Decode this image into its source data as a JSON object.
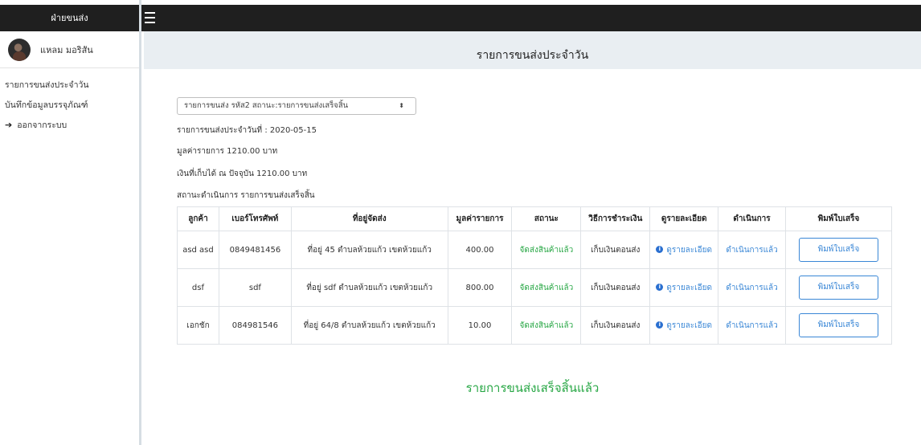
{
  "sidebar": {
    "header": "ฝ่ายขนส่ง",
    "user_name": "แหลม มอริสัน",
    "items": [
      {
        "label": "รายการขนส่งประจำวัน"
      },
      {
        "label": "บันทึกข้อมูลบรรจุภัณฑ์"
      },
      {
        "label": "ออกจากระบบ",
        "icon": "sign-out-icon"
      }
    ]
  },
  "main": {
    "title": "รายการขนส่งประจำวัน",
    "select_value": "รายการขนส่ง รหัส2 สถานะ:รายการขนส่งเสร็จสิ้น",
    "info": {
      "date": "รายการขนส่งประจำวันที่ : 2020-05-15",
      "total": "มูลค่ารายการ 1210.00 บาท",
      "collected": "เงินที่เก็บได้ ณ ปัจจุบัน 1210.00 บาท",
      "status": "สถานะดำเนินการ รายการขนส่งเสร็จสิ้น"
    },
    "table": {
      "headers": [
        "ลูกค้า",
        "เบอร์โทรศัพท์",
        "ที่อยู่จัดส่ง",
        "มูลค่ารายการ",
        "สถานะ",
        "วิธีการชำระเงิน",
        "ดูรายละเอียด",
        "ดำเนินการ",
        "พิมพ์ใบเสร็จ"
      ],
      "rows": [
        {
          "customer": "asd asd",
          "phone": "0849481456",
          "address": "ที่อยู่ 45 ตำบลห้วยแก้ว เขตห้วยแก้ว",
          "amount": "400.00",
          "status": "จัดส่งสินค้าแล้ว",
          "payment": "เก็บเงินตอนส่ง",
          "detail": "ดูรายละเอียด",
          "action": "ดำเนินการแล้ว",
          "print": "พิมพ์ใบเสร็จ"
        },
        {
          "customer": "dsf",
          "phone": "sdf",
          "address": "ที่อยู่ sdf ตำบลห้วยแก้ว เขตห้วยแก้ว",
          "amount": "800.00",
          "status": "จัดส่งสินค้าแล้ว",
          "payment": "เก็บเงินตอนส่ง",
          "detail": "ดูรายละเอียด",
          "action": "ดำเนินการแล้ว",
          "print": "พิมพ์ใบเสร็จ"
        },
        {
          "customer": "เอกชัก",
          "phone": "084981546",
          "address": "ที่อยู่ 64/8 ตำบลห้วยแก้ว เขตห้วยแก้ว",
          "amount": "10.00",
          "status": "จัดส่งสินค้าแล้ว",
          "payment": "เก็บเงินตอนส่ง",
          "detail": "ดูรายละเอียด",
          "action": "ดำเนินการแล้ว",
          "print": "พิมพ์ใบเสร็จ"
        }
      ]
    },
    "done_message": "รายการขนส่งเสร็จสิ้นแล้ว"
  },
  "colors": {
    "success": "#28a745",
    "link": "#3a87d6",
    "navbar": "#1f1f1f"
  }
}
